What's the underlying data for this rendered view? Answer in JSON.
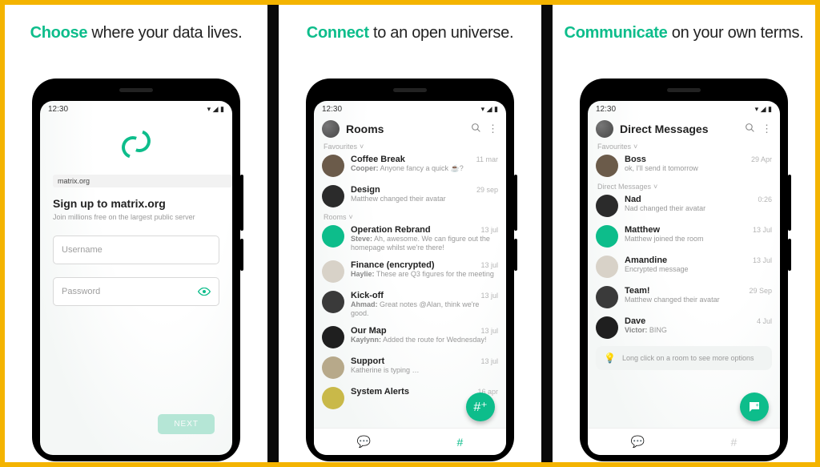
{
  "panels": [
    {
      "accent": "Choose",
      "rest": " where your data lives."
    },
    {
      "accent": "Connect",
      "rest": " to an open universe."
    },
    {
      "accent": "Communicate",
      "rest": " on your own terms."
    }
  ],
  "status": {
    "time": "12:30",
    "icons": "▾  ◢  ▮"
  },
  "s1": {
    "server_chip": "matrix.org",
    "title": "Sign up to matrix.org",
    "subtitle": "Join millions free on the largest public server",
    "username_ph": "Username",
    "password_ph": "Password",
    "next_label": "NEXT"
  },
  "s2": {
    "title": "Rooms",
    "section_fav": "Favourites",
    "section_rooms": "Rooms",
    "rows_fav": [
      {
        "name": "Coffee Break",
        "date": "11 mar",
        "msg": "<b>Cooper:</b> Anyone fancy a quick ☕?"
      },
      {
        "name": "Design",
        "date": "29 sep",
        "msg": "Matthew changed their avatar"
      }
    ],
    "rows_rooms": [
      {
        "name": "Operation Rebrand",
        "date": "13 jul",
        "msg": "<b>Steve:</b> Ah, awesome. We can figure out the homepage whilst we're there!"
      },
      {
        "name": "Finance (encrypted)",
        "date": "13 jul",
        "msg": "<b>Haylie:</b> These are Q3 figures for the meeting"
      },
      {
        "name": "Kick-off",
        "date": "13 jul",
        "msg": "<b>Ahmad:</b> Great notes @Alan, think we're good."
      },
      {
        "name": "Our Map",
        "date": "13 jul",
        "msg": "<b>Kaylynn:</b> Added the route for Wednesday!"
      },
      {
        "name": "Support",
        "date": "13 jul",
        "msg": "Katherine is typing …"
      },
      {
        "name": "System Alerts",
        "date": "16 apr",
        "msg": ""
      }
    ]
  },
  "s3": {
    "title": "Direct Messages",
    "section_fav": "Favourites",
    "section_dm": "Direct Messages",
    "rows_fav": [
      {
        "name": "Boss",
        "date": "29 Apr",
        "msg": "ok, I'll send it tomorrow"
      }
    ],
    "rows_dm": [
      {
        "name": "Nad",
        "date": "0:26",
        "msg": "Nad changed their avatar"
      },
      {
        "name": "Matthew",
        "date": "13 Jul",
        "msg": "Matthew joined the room"
      },
      {
        "name": "Amandine",
        "date": "13 Jul",
        "msg": "Encrypted message"
      },
      {
        "name": "Team!",
        "date": "29 Sep",
        "msg": "Matthew changed their avatar"
      },
      {
        "name": "Dave",
        "date": "4 Jul",
        "msg": "<b>Victor:</b> BING"
      }
    ],
    "hint": "Long click on a room to see more options"
  }
}
